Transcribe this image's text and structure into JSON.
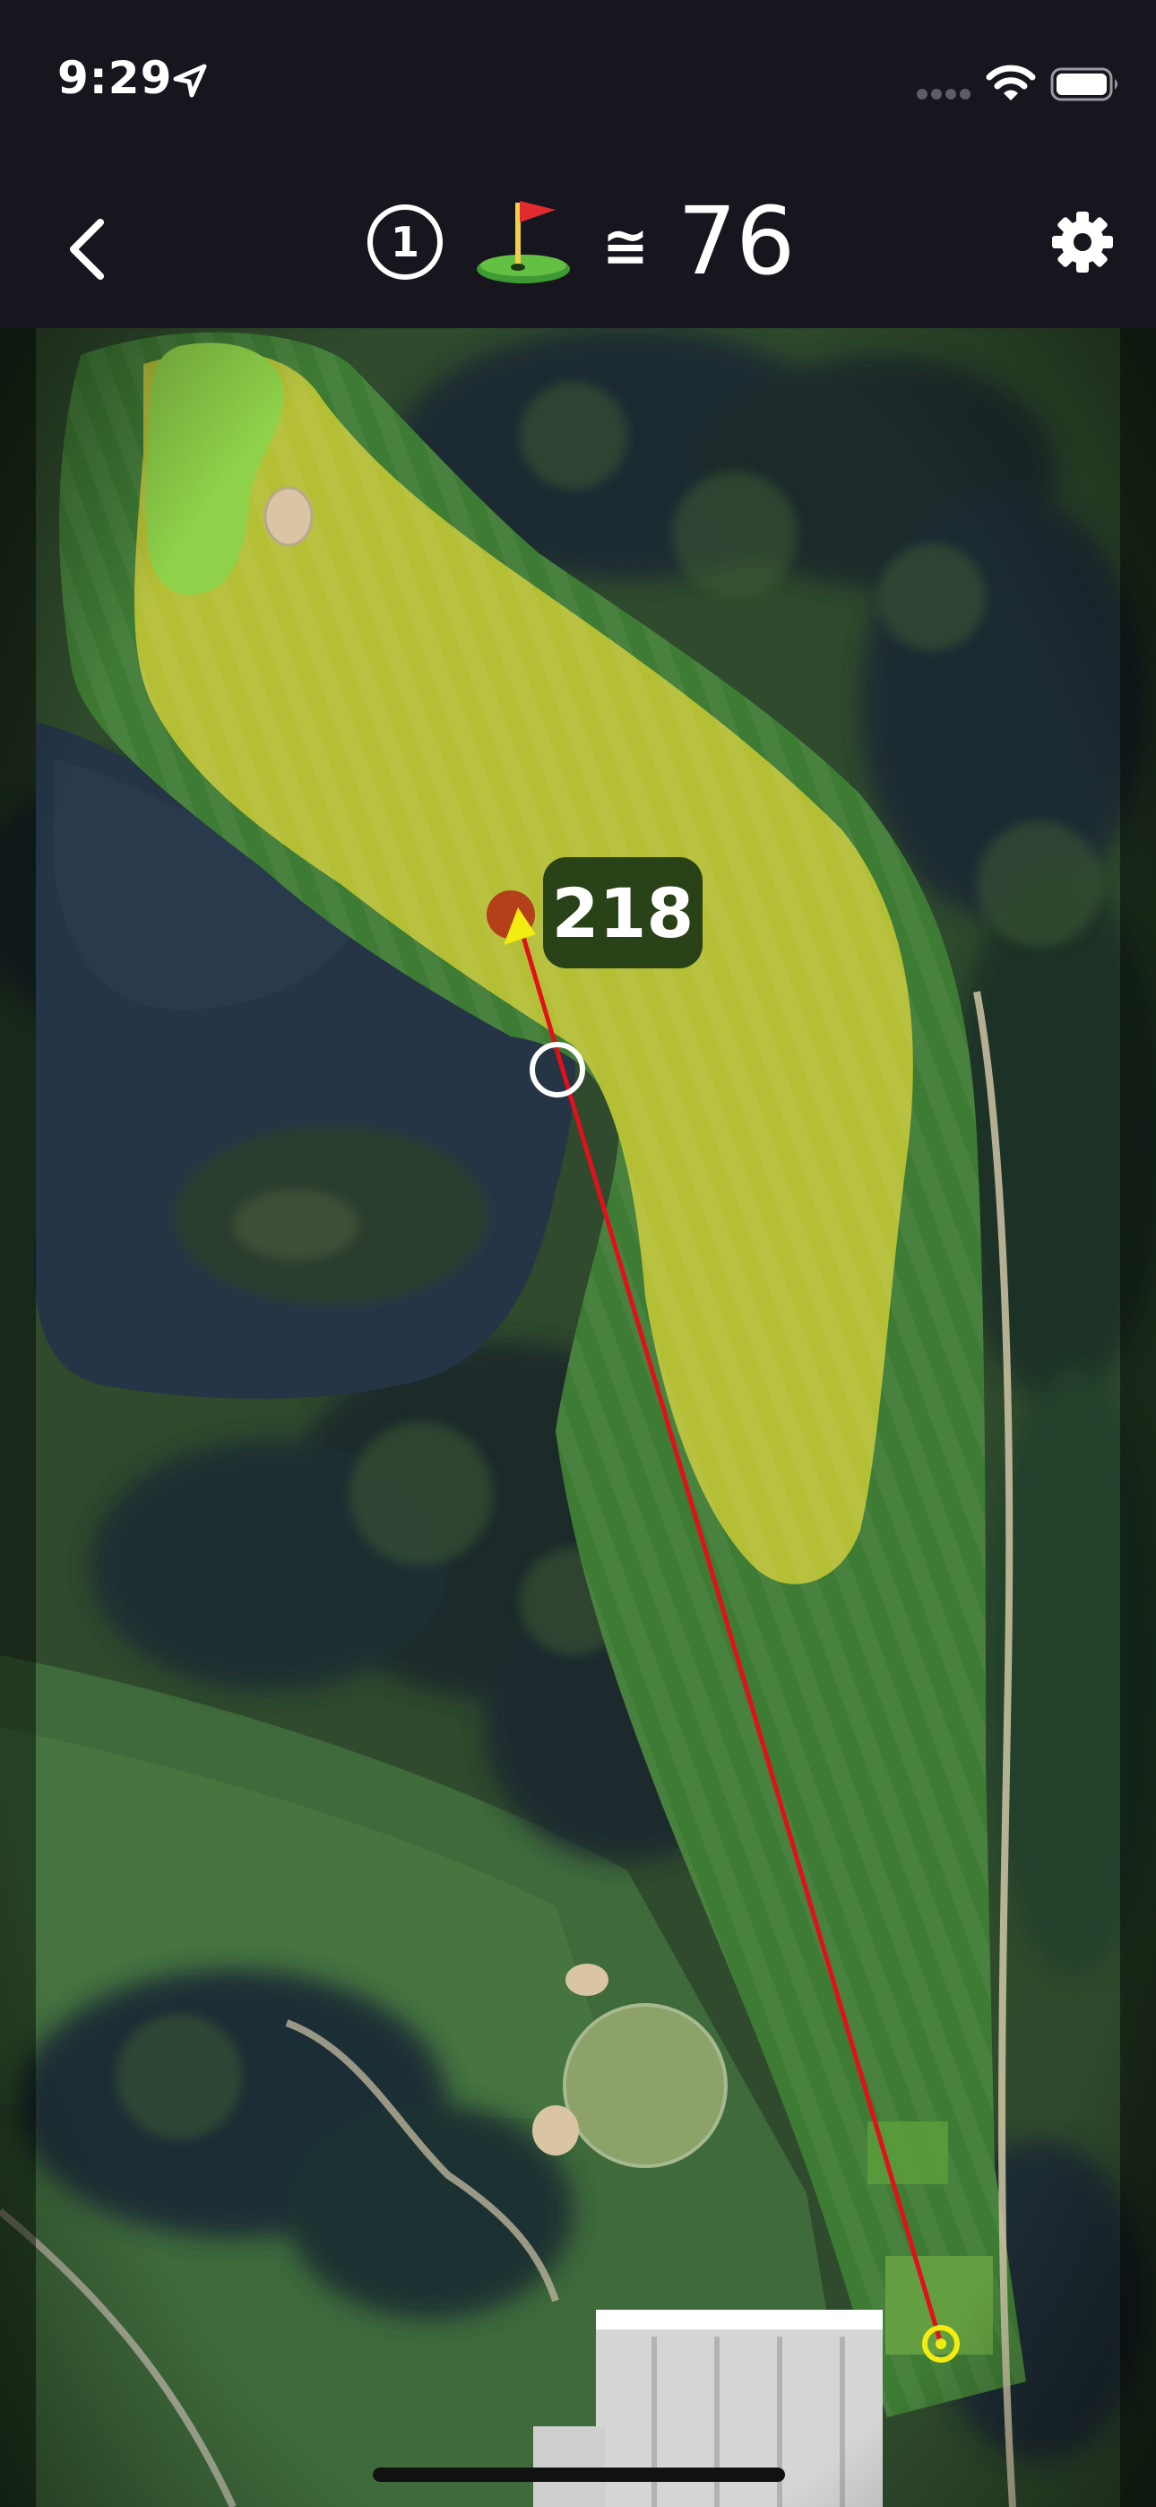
{
  "status_bar": {
    "time": "9:29",
    "icons": [
      "location-arrow-icon",
      "cellular-signal-icon",
      "wifi-icon",
      "battery-icon"
    ]
  },
  "nav": {
    "back_icon": "chevron-left-icon",
    "hole_number": "1",
    "flag_icon": "golf-flag-icon",
    "approx_symbol": "≅",
    "distance": "76",
    "settings_icon": "gear-icon"
  },
  "map": {
    "shot_distance": "218",
    "colors": {
      "shot_line": "#e1101a",
      "tee_marker": "#f2ec11",
      "ball_marker": "#b4401a",
      "aim_ring": "#ffffff",
      "fairway": "#b8c33a",
      "green": "#8fd24a",
      "bunker": "#d9c4a4",
      "water": "#253546"
    }
  }
}
